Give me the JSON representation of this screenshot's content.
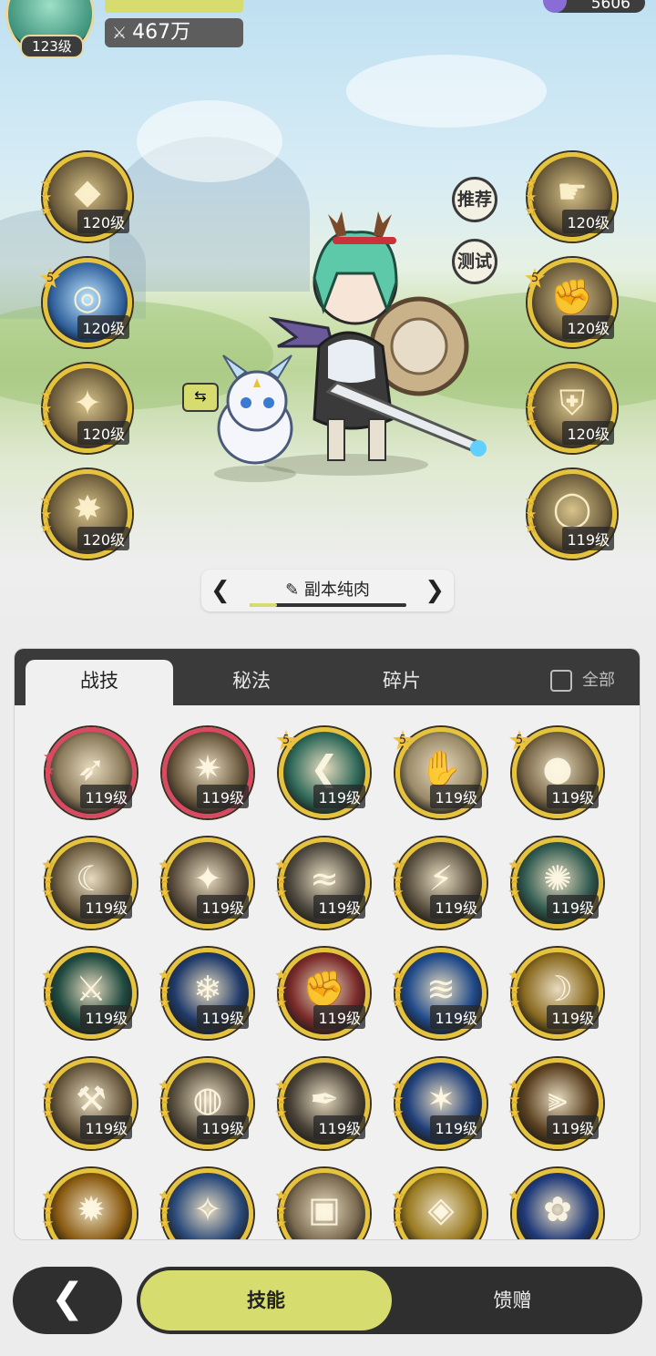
{
  "hud": {
    "player_level": "123级",
    "power": "467万",
    "currency": "5606"
  },
  "side_buttons": {
    "recommend": "推荐",
    "test": "测试"
  },
  "left_skills": [
    {
      "icon": "gem-up-icon",
      "level": "120级",
      "stars": 3,
      "star_badge": ""
    },
    {
      "icon": "crystal-ring-icon",
      "level": "120级",
      "stars": 0,
      "star_badge": "5"
    },
    {
      "icon": "sparkle-icon",
      "level": "120级",
      "stars": 3,
      "star_badge": ""
    },
    {
      "icon": "owl-burst-icon",
      "level": "120级",
      "stars": 3,
      "star_badge": ""
    }
  ],
  "right_skills": [
    {
      "icon": "pointing-hand-icon",
      "level": "120级",
      "stars": 3,
      "star_badge": ""
    },
    {
      "icon": "fists-icon",
      "level": "120级",
      "stars": 0,
      "star_badge": "5"
    },
    {
      "icon": "shield-icon",
      "level": "120级",
      "stars": 3,
      "star_badge": ""
    },
    {
      "icon": "ring-icon",
      "level": "119级",
      "stars": 3,
      "star_badge": ""
    }
  ],
  "preset": {
    "name": "副本纯肉"
  },
  "panel": {
    "tabs": [
      "战技",
      "秘法",
      "碎片"
    ],
    "active_tab": "战技",
    "all_label": "全部"
  },
  "skill_grid": [
    {
      "level": "119级",
      "border": "red",
      "stars": "red2",
      "badge": "",
      "bg": "#8a7a5a"
    },
    {
      "level": "119级",
      "border": "red",
      "stars": "none",
      "badge": "",
      "bg": "#6b5a40"
    },
    {
      "level": "119级",
      "border": "gold",
      "stars": "none",
      "badge": "5",
      "bg": "#2f6a5a"
    },
    {
      "level": "119级",
      "border": "gold",
      "stars": "none",
      "badge": "5",
      "bg": "#9a8a68"
    },
    {
      "level": "119级",
      "border": "gold",
      "stars": "none",
      "badge": "5",
      "bg": "#7a6848"
    },
    {
      "level": "119级",
      "border": "gold",
      "stars": "gold3",
      "badge": "",
      "bg": "#6e5e42"
    },
    {
      "level": "119级",
      "border": "gold",
      "stars": "gold3",
      "badge": "",
      "bg": "#5e5040"
    },
    {
      "level": "119级",
      "border": "gold",
      "stars": "gold3",
      "badge": "",
      "bg": "#4f4a40"
    },
    {
      "level": "119级",
      "border": "gold",
      "stars": "gold3",
      "badge": "",
      "bg": "#5a5040"
    },
    {
      "level": "119级",
      "border": "gold",
      "stars": "gold3",
      "badge": "",
      "bg": "#2f5a50"
    },
    {
      "level": "119级",
      "border": "gold",
      "stars": "gold3",
      "badge": "",
      "bg": "#1f4a40"
    },
    {
      "level": "119级",
      "border": "gold",
      "stars": "gold3",
      "badge": "",
      "bg": "#1f3a6a"
    },
    {
      "level": "119级",
      "border": "gold",
      "stars": "gold3",
      "badge": "",
      "bg": "#7a2a2a"
    },
    {
      "level": "119级",
      "border": "gold",
      "stars": "gold3",
      "badge": "",
      "bg": "#1f4a8a"
    },
    {
      "level": "119级",
      "border": "gold",
      "stars": "gold3",
      "badge": "",
      "bg": "#8a6a20"
    },
    {
      "level": "119级",
      "border": "gold",
      "stars": "gold3",
      "badge": "",
      "bg": "#6a5a40"
    },
    {
      "level": "119级",
      "border": "gold",
      "stars": "gold3",
      "badge": "",
      "bg": "#5a5040"
    },
    {
      "level": "119级",
      "border": "gold",
      "stars": "gold3",
      "badge": "",
      "bg": "#4a4238"
    },
    {
      "level": "119级",
      "border": "gold",
      "stars": "gold3",
      "badge": "",
      "bg": "#1f3f7a"
    },
    {
      "level": "119级",
      "border": "gold",
      "stars": "gold3",
      "badge": "",
      "bg": "#5a4020"
    },
    {
      "level": "",
      "border": "gold",
      "stars": "gold3",
      "badge": "",
      "bg": "#8a5a10"
    },
    {
      "level": "",
      "border": "gold",
      "stars": "gold3",
      "badge": "",
      "bg": "#2a4a7a"
    },
    {
      "level": "",
      "border": "gold",
      "stars": "gold3",
      "badge": "",
      "bg": "#7a6a50"
    },
    {
      "level": "",
      "border": "gold",
      "stars": "gold3",
      "badge": "",
      "bg": "#9a7a20"
    },
    {
      "level": "",
      "border": "gold",
      "stars": "gold1",
      "badge": "",
      "bg": "#1f3a7a"
    }
  ],
  "bottom": {
    "skill_label": "技能",
    "gift_label": "馈赠"
  }
}
